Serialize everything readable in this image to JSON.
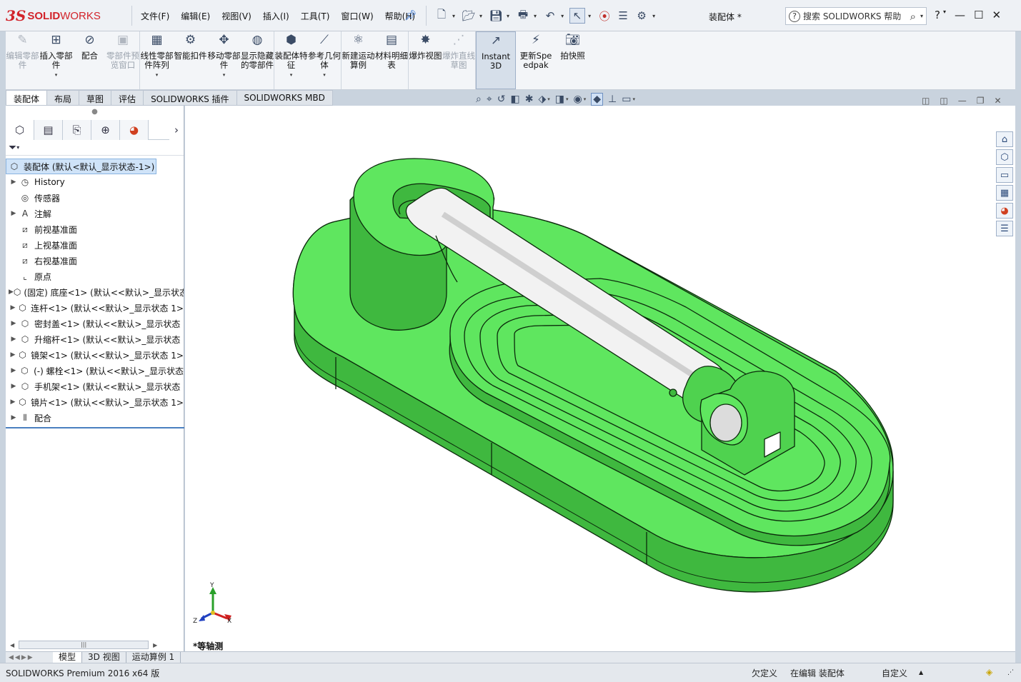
{
  "app": {
    "logo_ds": "3S",
    "logo_name_bold": "SOLID",
    "logo_name": "WORKS",
    "document_title": "装配体 *",
    "search_placeholder": "搜索 SOLIDWORKS 帮助",
    "help_glyph": "?",
    "menus": [
      "文件(F)",
      "编辑(E)",
      "视图(V)",
      "插入(I)",
      "工具(T)",
      "窗口(W)",
      "帮助(H)"
    ]
  },
  "commands": [
    {
      "label": "编辑零部件",
      "icon": "edit-component-icon",
      "disabled": true,
      "dropdown": false
    },
    {
      "label": "插入零部件",
      "icon": "insert-component-icon",
      "disabled": false,
      "dropdown": true
    },
    {
      "label": "配合",
      "icon": "mate-icon",
      "disabled": false,
      "dropdown": false
    },
    {
      "label": "零部件预览窗口",
      "icon": "component-preview-icon",
      "disabled": true,
      "dropdown": false
    },
    {
      "label": "线性零部件阵列",
      "icon": "linear-pattern-icon",
      "disabled": false,
      "dropdown": true
    },
    {
      "label": "智能扣件",
      "icon": "smart-fastener-icon",
      "disabled": false,
      "dropdown": false
    },
    {
      "label": "移动零部件",
      "icon": "move-component-icon",
      "disabled": false,
      "dropdown": true
    },
    {
      "label": "显示隐藏的零部件",
      "icon": "show-hidden-icon",
      "disabled": false,
      "dropdown": false
    },
    {
      "label": "装配体特征",
      "icon": "assembly-feature-icon",
      "disabled": false,
      "dropdown": true
    },
    {
      "label": "参考几何体",
      "icon": "reference-geometry-icon",
      "disabled": false,
      "dropdown": true
    },
    {
      "label": "新建运动算例",
      "icon": "motion-study-icon",
      "disabled": false,
      "dropdown": false
    },
    {
      "label": "材料明细表",
      "icon": "bom-icon",
      "disabled": false,
      "dropdown": false
    },
    {
      "label": "爆炸视图",
      "icon": "exploded-view-icon",
      "disabled": false,
      "dropdown": false
    },
    {
      "label": "爆炸直线草图",
      "icon": "explode-line-icon",
      "disabled": true,
      "dropdown": false
    },
    {
      "label": "Instant3D",
      "icon": "instant3d-icon",
      "disabled": false,
      "dropdown": false
    },
    {
      "label": "更新Speedpak",
      "icon": "speedpak-icon",
      "disabled": false,
      "dropdown": false
    },
    {
      "label": "拍快照",
      "icon": "snapshot-icon",
      "disabled": false,
      "dropdown": false
    }
  ],
  "cmd_tabs": [
    "装配体",
    "布局",
    "草图",
    "评估",
    "SOLIDWORKS 插件",
    "SOLIDWORKS MBD"
  ],
  "tree": {
    "root": "装配体 (默认<默认_显示状态-1>)",
    "nodes": [
      {
        "label": "History",
        "icon": "history-icon",
        "expandable": true
      },
      {
        "label": "传感器",
        "icon": "sensor-icon",
        "expandable": false
      },
      {
        "label": "注解",
        "icon": "annotation-icon",
        "expandable": true
      },
      {
        "label": "前视基准面",
        "icon": "plane-icon",
        "expandable": false
      },
      {
        "label": "上视基准面",
        "icon": "plane-icon",
        "expandable": false
      },
      {
        "label": "右视基准面",
        "icon": "plane-icon",
        "expandable": false
      },
      {
        "label": "原点",
        "icon": "origin-icon",
        "expandable": false
      },
      {
        "label": "(固定) 底座<1> (默认<<默认>_显示状态",
        "icon": "part-icon",
        "expandable": true
      },
      {
        "label": "连杆<1> (默认<<默认>_显示状态 1>",
        "icon": "part-icon",
        "expandable": true
      },
      {
        "label": "密封盖<1> (默认<<默认>_显示状态",
        "icon": "part-icon",
        "expandable": true
      },
      {
        "label": "升缩杆<1> (默认<<默认>_显示状态",
        "icon": "part-icon",
        "expandable": true
      },
      {
        "label": "镜架<1> (默认<<默认>_显示状态 1>",
        "icon": "part-icon",
        "expandable": true
      },
      {
        "label": "(-) 螺栓<1> (默认<<默认>_显示状态",
        "icon": "part-icon",
        "expandable": true
      },
      {
        "label": "手机架<1> (默认<<默认>_显示状态",
        "icon": "part-icon",
        "expandable": true
      },
      {
        "label": "镜片<1> (默认<<默认>_显示状态 1>",
        "icon": "part-icon",
        "expandable": true
      },
      {
        "label": "配合",
        "icon": "mates-folder-icon",
        "expandable": true
      }
    ]
  },
  "viewport": {
    "view_name": "*等轴测",
    "axes": {
      "x": "X",
      "y": "Y",
      "z": "Z"
    },
    "model_color": "#5fe65f",
    "model_edge": "#0b2a0b"
  },
  "bottom_tabs": [
    "模型",
    "3D 视图",
    "运动算例 1"
  ],
  "status": {
    "product": "SOLIDWORKS Premium 2016 x64 版",
    "definition": "欠定义",
    "editing": "在编辑 装配体",
    "units": "自定义"
  }
}
